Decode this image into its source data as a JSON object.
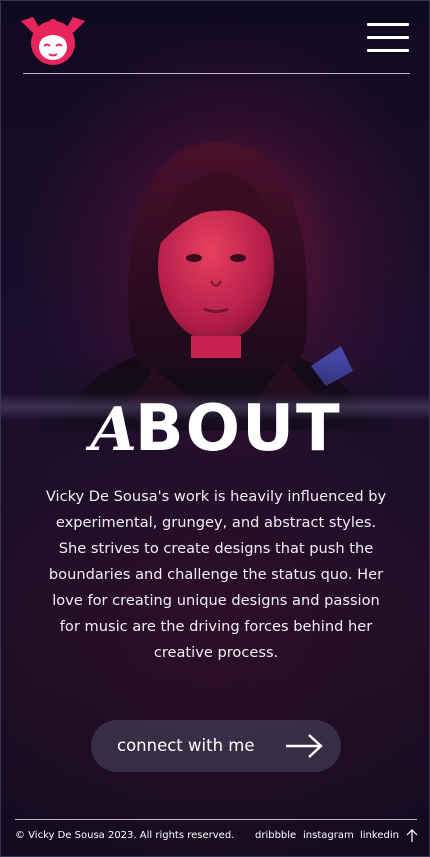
{
  "header": {
    "logo_icon": "girl-face-logo-icon",
    "menu_icon": "hamburger-menu-icon"
  },
  "hero": {
    "image": "portrait-photo",
    "title_first_letter": "A",
    "title_rest": "BOUT"
  },
  "about": {
    "bio": "Vicky De Sousa's work is heavily influenced by experimental, grungey, and abstract styles. She strives to create designs that push the boundaries and challenge the status quo. Her love for creating unique designs and passion for music are the driving forces behind her creative process."
  },
  "cta": {
    "label": "connect with me",
    "icon": "arrow-right-icon"
  },
  "footer": {
    "copyright": "© Vicky De Sousa 2023. All rights reserved.",
    "links": [
      "dribbble",
      "instagram",
      "linkedin"
    ],
    "back_to_top_icon": "arrow-up-icon"
  },
  "colors": {
    "accent": "#e8245c",
    "background": "#150d22",
    "button_bg": "#3e384e"
  }
}
